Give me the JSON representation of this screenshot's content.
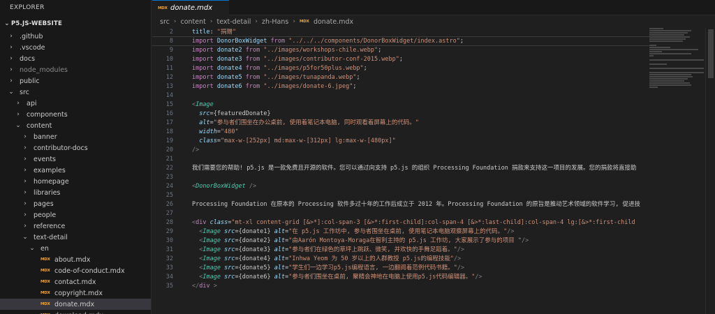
{
  "sidebar": {
    "header": "EXPLORER",
    "project": "P5.JS-WEBSITE",
    "items": [
      {
        "label": ".github",
        "chevron": "›"
      },
      {
        "label": ".vscode",
        "chevron": "›"
      },
      {
        "label": "docs",
        "chevron": "›"
      },
      {
        "label": "node_modules",
        "chevron": "›"
      },
      {
        "label": "public",
        "chevron": "›"
      },
      {
        "label": "src",
        "chevron": "⌄"
      },
      {
        "label": "api",
        "chevron": "›"
      },
      {
        "label": "components",
        "chevron": "›"
      },
      {
        "label": "content",
        "chevron": "⌄"
      },
      {
        "label": "banner",
        "chevron": "›"
      },
      {
        "label": "contributor-docs",
        "chevron": "›"
      },
      {
        "label": "events",
        "chevron": "›"
      },
      {
        "label": "examples",
        "chevron": "›"
      },
      {
        "label": "homepage",
        "chevron": "›"
      },
      {
        "label": "libraries",
        "chevron": "›"
      },
      {
        "label": "pages",
        "chevron": "›"
      },
      {
        "label": "people",
        "chevron": "›"
      },
      {
        "label": "reference",
        "chevron": "›"
      },
      {
        "label": "text-detail",
        "chevron": "⌄"
      },
      {
        "label": "en",
        "chevron": "⌄"
      },
      {
        "label": "about.mdx",
        "icon": "MDX"
      },
      {
        "label": "code-of-conduct.mdx",
        "icon": "MDX"
      },
      {
        "label": "contact.mdx",
        "icon": "MDX"
      },
      {
        "label": "copyright.mdx",
        "icon": "MDX"
      },
      {
        "label": "donate.mdx",
        "icon": "MDX"
      },
      {
        "label": "download.mdx",
        "icon": "MDX"
      }
    ]
  },
  "tab": {
    "icon": "MDX",
    "title": "donate.mdx"
  },
  "breadcrumb": {
    "parts": [
      "src",
      "content",
      "text-detail",
      "zh-Hans"
    ],
    "sep": "›",
    "file_icon": "MDX",
    "file": "donate.mdx"
  },
  "code": {
    "line_numbers": [
      "2",
      "8",
      "9",
      "10",
      "11",
      "12",
      "13",
      "14",
      "15",
      "16",
      "17",
      "18",
      "19",
      "20",
      "21",
      "22",
      "23",
      "24",
      "25",
      "26",
      "27",
      "28",
      "29",
      "30",
      "31",
      "32",
      "33",
      "34",
      "35"
    ],
    "l2": {
      "key": "title",
      "colon": ": ",
      "value": "\"捐赠\""
    },
    "l8": {
      "kw": "import",
      "name": " DonorBoxWidget ",
      "from": "from",
      "path": " \"../../../components/DonorBoxWidget/index.astro\"",
      "end": ";"
    },
    "l9": {
      "kw": "import",
      "name": " donate2 ",
      "from": "from",
      "path": " \"../images/workshops-chile.webp\"",
      "end": ";"
    },
    "l10": {
      "kw": "import",
      "name": " donate3 ",
      "from": "from",
      "path": " \"../images/contributor-conf-2015.webp\"",
      "end": ";"
    },
    "l11": {
      "kw": "import",
      "name": " donate4 ",
      "from": "from",
      "path": " \"../images/p5for50plus.webp\"",
      "end": ";"
    },
    "l12": {
      "kw": "import",
      "name": " donate5 ",
      "from": "from",
      "path": " \"../images/tunapanda.webp\"",
      "end": ";"
    },
    "l13": {
      "kw": "import",
      "name": " donate6 ",
      "from": "from",
      "path": " \"../images/donate-6.jpeg\"",
      "end": ";"
    },
    "l15": {
      "open": "<",
      "tag": "Image"
    },
    "l16": {
      "attr": "src",
      "eq": "=",
      "val": "{featuredDonate}"
    },
    "l17": {
      "attr": "alt",
      "eq": "=",
      "val": "\"参与者们围坐在办公桌前, 使用着笔记本电脑, 同时观看着屏幕上的代码。\""
    },
    "l18": {
      "attr": "width",
      "eq": "=",
      "val": "\"480\""
    },
    "l19": {
      "attr": "class",
      "eq": "=",
      "val": "\"max-w-[252px] md:max-w-[312px] lg:max-w-[480px]\""
    },
    "l20": {
      "close": "/>"
    },
    "l22": {
      "text": "我们需要您的帮助! p5.js 是一款免费且开源的软件。您可以通过向支持 p5.js 的组织 Processing Foundation 捐款来支持这一项目的发展。您的捐款将直接助"
    },
    "l24": {
      "open": "<",
      "tag": "DonorBoxWidget",
      "close": " />"
    },
    "l26": {
      "text": "Processing Foundation 在原本的 Processing 软件多过十年的工作后成立于 2012 年。Processing Foundation 的原旨是推动艺术领域的软件学习, 促进技"
    },
    "l28": {
      "open": "<",
      "tag": "div",
      "attr": " class",
      "eq": "=",
      "val": "\"mt-xl content-grid [&>*]:col-span-3 [&>*:first-child]:col-span-4 [&>*:last-child]:col-span-4 lg:[&>*:first-child"
    },
    "img_lines": [
      {
        "src": "{donate1}",
        "alt": "\"在 p5.js 工作坊中, 参与者围坐在桌前, 使用笔记本电脑观察屏幕上的代码。\""
      },
      {
        "src": "{donate2}",
        "alt": "\"由Aarón Montoya-Moraga在智利主持的 p5.js 工作坊, 大家展示了参与的项目 \""
      },
      {
        "src": "{donate3}",
        "alt": "\"参与者们在绿色的草坪上跳跃、微笑, 并欢快的手舞足蹈着。\""
      },
      {
        "src": "{donate4}",
        "alt": "\"Inhwa Yeom 为 50 岁以上的人群教授 p5.js的编程技能\""
      },
      {
        "src": "{donate5}",
        "alt": "\"学生们一边学习p5.js编程语言, 一边翻阅着范例代码书籍。\""
      },
      {
        "src": "{donate6}",
        "alt": "\"参与者们围坐在桌前, 聚精会神地在电脑上使用p5.js代码编辑器。\""
      }
    ],
    "img_tag": "Image",
    "img_src_attr": "src",
    "img_alt_attr": "alt",
    "img_close": "/>",
    "l35": {
      "open": "</",
      "tag": "div",
      "close": " >"
    }
  }
}
